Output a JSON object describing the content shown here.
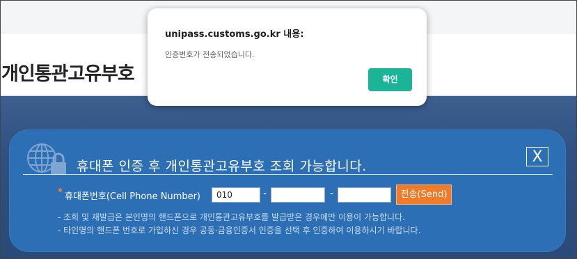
{
  "page": {
    "title": "개인통관고유부호"
  },
  "panel": {
    "heading": "휴대폰 인증 후 개인통관고유부호 조회 가능합니다.",
    "close_label": "X",
    "phone_required_mark": "*",
    "phone_label": "휴대폰번호(Cell Phone Number)",
    "phone_part1_value": "010",
    "phone_part2_value": "",
    "phone_part3_value": "",
    "dash1": "-",
    "dash2": "-",
    "send_label": "전송(Send)",
    "notes": [
      "- 조회 및 재발급은 본인명의 핸드폰으로 개인통관고유부호를 발급받은 경우에만 이용이 가능합니다.",
      "- 타인명의 핸드폰 번호로 가입하신 경우 공동·금융인증서 인증을 선택 후 인증하여 이용하시기 바랍니다."
    ]
  },
  "dialog": {
    "title": "unipass.customs.go.kr 내용:",
    "message": "인증번호가 전송되었습니다.",
    "ok_label": "확인"
  },
  "colors": {
    "panel_blue": "#2d6fb5",
    "send_orange": "#f07b2a",
    "ok_green": "#1bb497",
    "required_star": "#ff8a2a"
  },
  "icons": {
    "panel_icon": "globe-lock-icon",
    "close": "close-icon"
  }
}
